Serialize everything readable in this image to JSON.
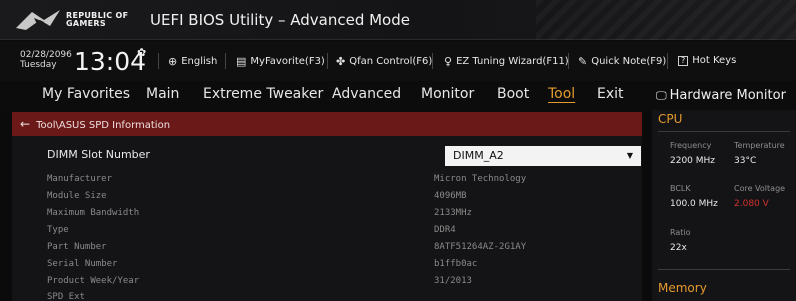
{
  "header": {
    "brand_line1": "REPUBLIC OF",
    "brand_line2": "GAMERS",
    "title": "UEFI BIOS Utility – Advanced Mode"
  },
  "infobar": {
    "date": "02/28/2096",
    "day": "Tuesday",
    "time": "13:04",
    "language": "English",
    "myfavorite": "MyFavorite(F3)",
    "qfan": "Qfan Control(F6)",
    "ez_tuning": "EZ Tuning Wizard(F11)",
    "quick_note": "Quick Note(F9)",
    "hot_keys": "Hot Keys",
    "hot_keys_box": "?"
  },
  "menu": {
    "items": [
      "My Favorites",
      "Main",
      "Extreme Tweaker",
      "Advanced",
      "Monitor",
      "Boot",
      "Tool",
      "Exit"
    ],
    "active": "Tool"
  },
  "main": {
    "breadcrumb": "Tool\\ASUS SPD Information",
    "dimm_label": "DIMM Slot Number",
    "dimm_value": "DIMM_A2",
    "rows": [
      {
        "key": "Manufacturer",
        "value": "Micron Technology"
      },
      {
        "key": "Module Size",
        "value": "4096MB"
      },
      {
        "key": "Maximum Bandwidth",
        "value": "2133MHz"
      },
      {
        "key": "Type",
        "value": "DDR4"
      },
      {
        "key": "Part Number",
        "value": "8ATF51264AZ-2G1AY"
      },
      {
        "key": "Serial Number",
        "value": "b1ffb0ac"
      },
      {
        "key": "Product Week/Year",
        "value": "31/2013"
      },
      {
        "key": "SPD Ext",
        "value": ""
      }
    ]
  },
  "hw_monitor": {
    "title": "Hardware Monitor",
    "cpu_title": "CPU",
    "frequency_label": "Frequency",
    "frequency_value": "2200 MHz",
    "temperature_label": "Temperature",
    "temperature_value": "33°C",
    "bclk_label": "BCLK",
    "bclk_value": "100.0 MHz",
    "core_voltage_label": "Core Voltage",
    "core_voltage_value": "2.080 V",
    "ratio_label": "Ratio",
    "ratio_value": "22x",
    "memory_title": "Memory"
  },
  "colors": {
    "accent": "#e59a2e",
    "breadcrumb_bg": "#6b1818",
    "warning": "#d6322d"
  }
}
